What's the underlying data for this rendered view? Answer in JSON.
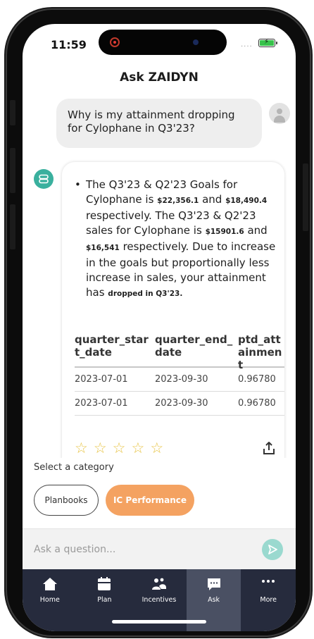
{
  "status_bar": {
    "time": "11:59",
    "signal": "....",
    "battery_charging": true
  },
  "header": {
    "title": "Ask ZAIDYN"
  },
  "user_message": {
    "text": "Why is my attainment dropping for Cylophane in Q3'23?"
  },
  "bot_message": {
    "bullet": "•",
    "t1": "The Q3'23 & Q2'23 Goals for Cylophane is ",
    "goal_q3": "$22,356.1",
    "t2": " and ",
    "goal_q2": "$18,490.4",
    "t3": " respectively. The Q3'23 & Q2'23 sales for Cylophane is ",
    "sales_q3": "$15901.6",
    "t4": " and ",
    "sales_q2": "$16,541",
    "t5": " respectively. Due to increase in the goals but proportionally less increase in sales, your attainment has ",
    "dropped": "dropped in Q3'23.",
    "table": {
      "headers": [
        "quarter_start_date",
        "quarter_end_date",
        "ptd_attainment"
      ],
      "rows": [
        [
          "2023-07-01",
          "2023-09-30",
          "0.96780"
        ],
        [
          "2023-07-01",
          "2023-09-30",
          "0.96780"
        ]
      ]
    },
    "rating": {
      "stars": 5,
      "selected": 0,
      "glyph": "☆",
      "color": "#e8c547"
    },
    "share_icon": "share-icon"
  },
  "category": {
    "label": "Select a category",
    "chips": [
      {
        "label": "Planbooks",
        "selected": false
      },
      {
        "label": "IC Performance",
        "selected": true
      }
    ],
    "accent": "#f4a261"
  },
  "input": {
    "placeholder": "Ask a question...",
    "value": "",
    "send_color": "#9ad9cf"
  },
  "nav": {
    "items": [
      {
        "label": "Home",
        "icon": "home-icon",
        "active": false
      },
      {
        "label": "Plan",
        "icon": "calendar-icon",
        "active": false
      },
      {
        "label": "Incentives",
        "icon": "incentives-icon",
        "active": false
      },
      {
        "label": "Ask",
        "icon": "chat-icon",
        "active": true
      },
      {
        "label": "More",
        "icon": "more-icon",
        "active": false
      }
    ],
    "background": "#262b3d",
    "active_background": "#4a5063"
  },
  "colors": {
    "bot_avatar": "#3ab09e"
  }
}
